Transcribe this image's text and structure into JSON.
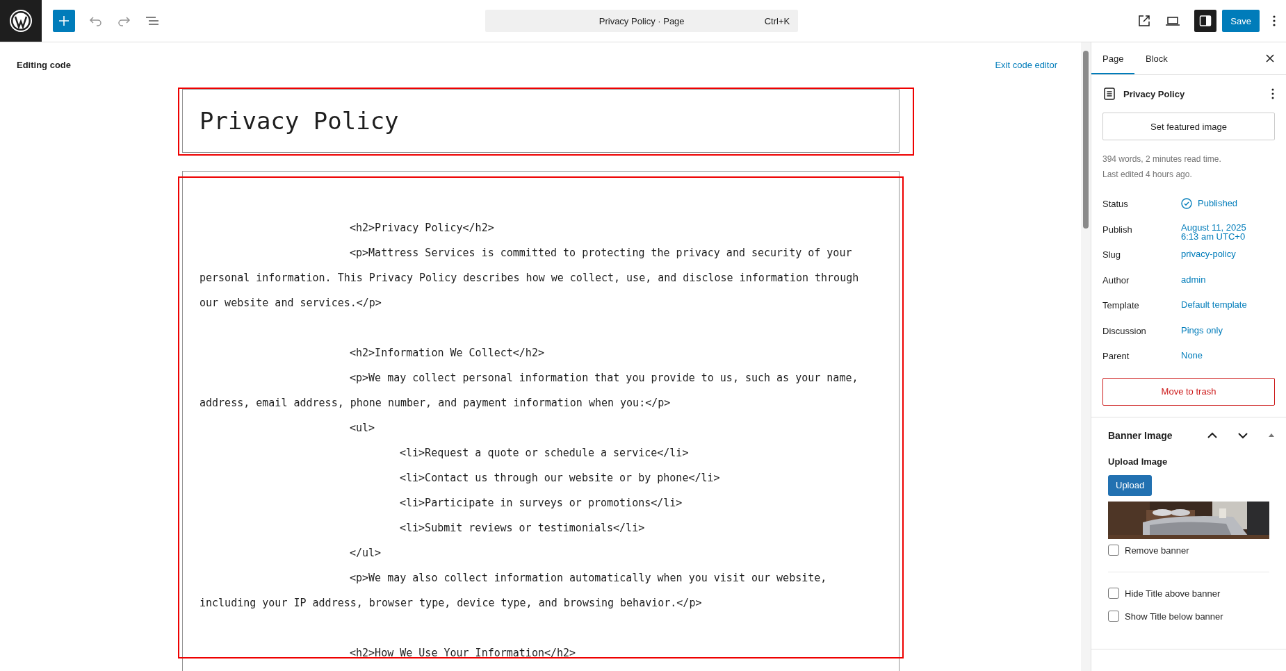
{
  "toolbar": {
    "command_title": "Privacy Policy · Page",
    "shortcut": "Ctrl+K",
    "save": "Save",
    "settings_open": true
  },
  "editor": {
    "mode_label": "Editing code",
    "exit_link": "Exit code editor",
    "title": "Privacy Policy",
    "lines": [
      {
        "kind": "indent1",
        "gap_before": true,
        "text": "<h2>Privacy Policy</h2>"
      },
      {
        "kind": "indent1",
        "gap_before": false,
        "text": "<p>Mattress Services is committed to protecting the privacy and security of your"
      },
      {
        "kind": "wrap",
        "gap_before": false,
        "text": "personal information. This Privacy Policy describes how we collect, use, and disclose information through"
      },
      {
        "kind": "wrap",
        "gap_before": false,
        "text": "our website and services.</p>"
      },
      {
        "kind": "indent1",
        "gap_before": true,
        "text": "<h2>Information We Collect</h2>"
      },
      {
        "kind": "indent1",
        "gap_before": false,
        "text": "<p>We may collect personal information that you provide to us, such as your name,"
      },
      {
        "kind": "wrap",
        "gap_before": false,
        "text": "address, email address, phone number, and payment information when you:</p>"
      },
      {
        "kind": "indent1",
        "gap_before": false,
        "text": "<ul>"
      },
      {
        "kind": "indent2",
        "gap_before": false,
        "text": "<li>Request a quote or schedule a service</li>"
      },
      {
        "kind": "indent2",
        "gap_before": false,
        "text": "<li>Contact us through our website or by phone</li>"
      },
      {
        "kind": "indent2",
        "gap_before": false,
        "text": "<li>Participate in surveys or promotions</li>"
      },
      {
        "kind": "indent2",
        "gap_before": false,
        "text": "<li>Submit reviews or testimonials</li>"
      },
      {
        "kind": "indent1",
        "gap_before": false,
        "text": "</ul>"
      },
      {
        "kind": "indent1",
        "gap_before": false,
        "text": "<p>We may also collect information automatically when you visit our website,"
      },
      {
        "kind": "wrap",
        "gap_before": false,
        "text": "including your IP address, browser type, device type, and browsing behavior.</p>"
      },
      {
        "kind": "indent1",
        "gap_before": true,
        "text": "<h2>How We Use Your Information</h2>"
      }
    ]
  },
  "sidebar": {
    "tabs": [
      {
        "label": "Page",
        "selected": true
      },
      {
        "label": "Block",
        "selected": false
      }
    ],
    "page_title": "Privacy Policy",
    "featured_button": "Set featured image",
    "meta": [
      "394 words, 2 minutes read time.",
      "Last edited 4 hours ago."
    ],
    "fields": [
      {
        "label": "Status",
        "kind": "status",
        "value": "Published"
      },
      {
        "label": "Publish",
        "kind": "date",
        "value": "August 11, 2025",
        "value_2": "6:13 am UTC+0"
      },
      {
        "label": "Slug",
        "kind": "link",
        "value": "privacy-policy"
      },
      {
        "label": "Author",
        "kind": "link",
        "value": "admin"
      },
      {
        "label": "Template",
        "kind": "link",
        "value": "Default template"
      },
      {
        "label": "Discussion",
        "kind": "link",
        "value": "Pings only"
      },
      {
        "label": "Parent",
        "kind": "link",
        "value": "None"
      }
    ],
    "trash_button": "Move to trash",
    "banner": {
      "title": "Banner Image",
      "expanded": true,
      "upload_label": "Upload Image",
      "upload_button": "Upload",
      "options": [
        {
          "label": "Remove banner",
          "checked": false,
          "divider_after": true
        },
        {
          "label": "Hide Title above banner",
          "checked": false,
          "divider_after": false
        },
        {
          "label": "Show Title below banner",
          "checked": false,
          "divider_after": false
        }
      ]
    }
  }
}
